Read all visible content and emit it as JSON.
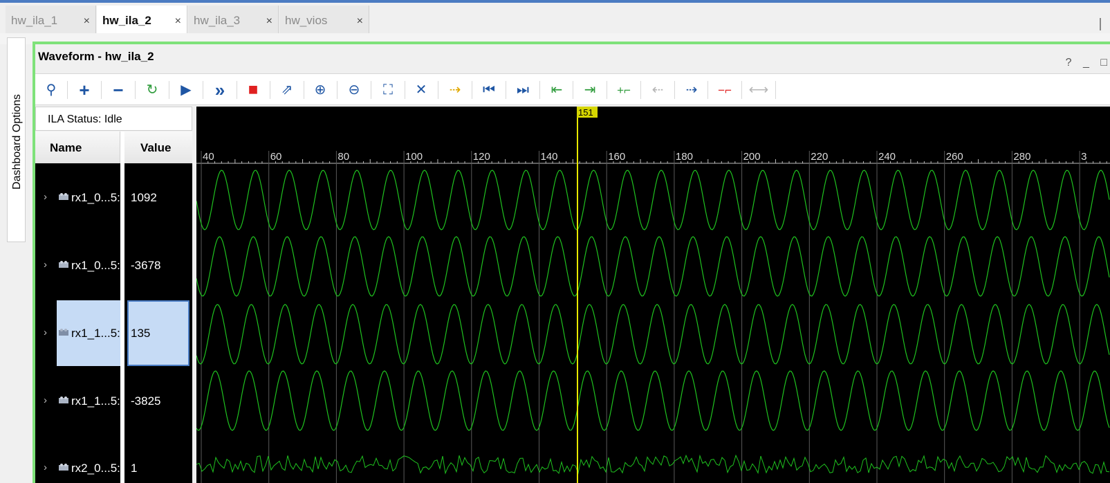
{
  "tabs": [
    {
      "label": "hw_ila_1",
      "active": false
    },
    {
      "label": "hw_ila_2",
      "active": true
    },
    {
      "label": "hw_ila_3",
      "active": false
    },
    {
      "label": "hw_vios",
      "active": false
    }
  ],
  "tab_close_glyph": "×",
  "sidebar": {
    "label": "Dashboard Options"
  },
  "panel": {
    "title": "Waveform - hw_ila_2",
    "help": "?",
    "minimize": "_",
    "maximize": "□"
  },
  "toolbar": {
    "buttons": [
      {
        "name": "search-icon",
        "glyph": "⚲"
      },
      {
        "name": "add-icon",
        "glyph": "+"
      },
      {
        "name": "remove-icon",
        "glyph": "−"
      },
      {
        "name": "refresh-trigger-icon",
        "glyph": "↻"
      },
      {
        "name": "run-trigger-icon",
        "glyph": "▶"
      },
      {
        "name": "run-immediate-icon",
        "glyph": "»"
      },
      {
        "name": "stop-icon",
        "glyph": "■"
      },
      {
        "name": "export-icon",
        "glyph": "⇗"
      },
      {
        "name": "zoom-in-icon",
        "glyph": "⊕"
      },
      {
        "name": "zoom-out-icon",
        "glyph": "⊖"
      },
      {
        "name": "zoom-fit-icon",
        "glyph": "⛶"
      },
      {
        "name": "cursor-icon",
        "glyph": "✕"
      },
      {
        "name": "goto-cursor-icon",
        "glyph": "⇢"
      },
      {
        "name": "go-to-start-icon",
        "glyph": "⏮"
      },
      {
        "name": "go-to-end-icon",
        "glyph": "⏭"
      },
      {
        "name": "previous-transition-icon",
        "glyph": "⇤"
      },
      {
        "name": "next-transition-icon",
        "glyph": "⇥"
      },
      {
        "name": "add-marker-icon",
        "glyph": "+⌐"
      },
      {
        "name": "previous-marker-icon",
        "glyph": "⇠"
      },
      {
        "name": "next-marker-icon",
        "glyph": "⇢"
      },
      {
        "name": "delete-marker-icon",
        "glyph": "−⌐"
      },
      {
        "name": "swap-markers-icon",
        "glyph": "⟷"
      }
    ]
  },
  "status": {
    "label": "ILA Status:",
    "value": "Idle"
  },
  "columns": {
    "name": "Name",
    "value": "Value"
  },
  "signals": [
    {
      "name": "rx1_0...5:",
      "value": "1092",
      "selected": false
    },
    {
      "name": "rx1_0...5:",
      "value": "-3678",
      "selected": false
    },
    {
      "name": "rx1_1...5:",
      "value": "135",
      "selected": true
    },
    {
      "name": "rx1_1...5:",
      "value": "-3825",
      "selected": false
    },
    {
      "name": "rx2_0...5:",
      "value": "1",
      "selected": false
    }
  ],
  "chevron": "›",
  "timeline": {
    "ticks": [
      "40",
      "60",
      "80",
      "100",
      "120",
      "140",
      "160",
      "180",
      "200",
      "220",
      "240",
      "260",
      "280",
      "3"
    ],
    "cursor_label": "151"
  },
  "colors": {
    "wave": "#1fc21f",
    "cursor": "#e8e800",
    "grid": "#5a5a5a",
    "panel_border": "#7fe27a",
    "selection": "#c6dbf5"
  }
}
